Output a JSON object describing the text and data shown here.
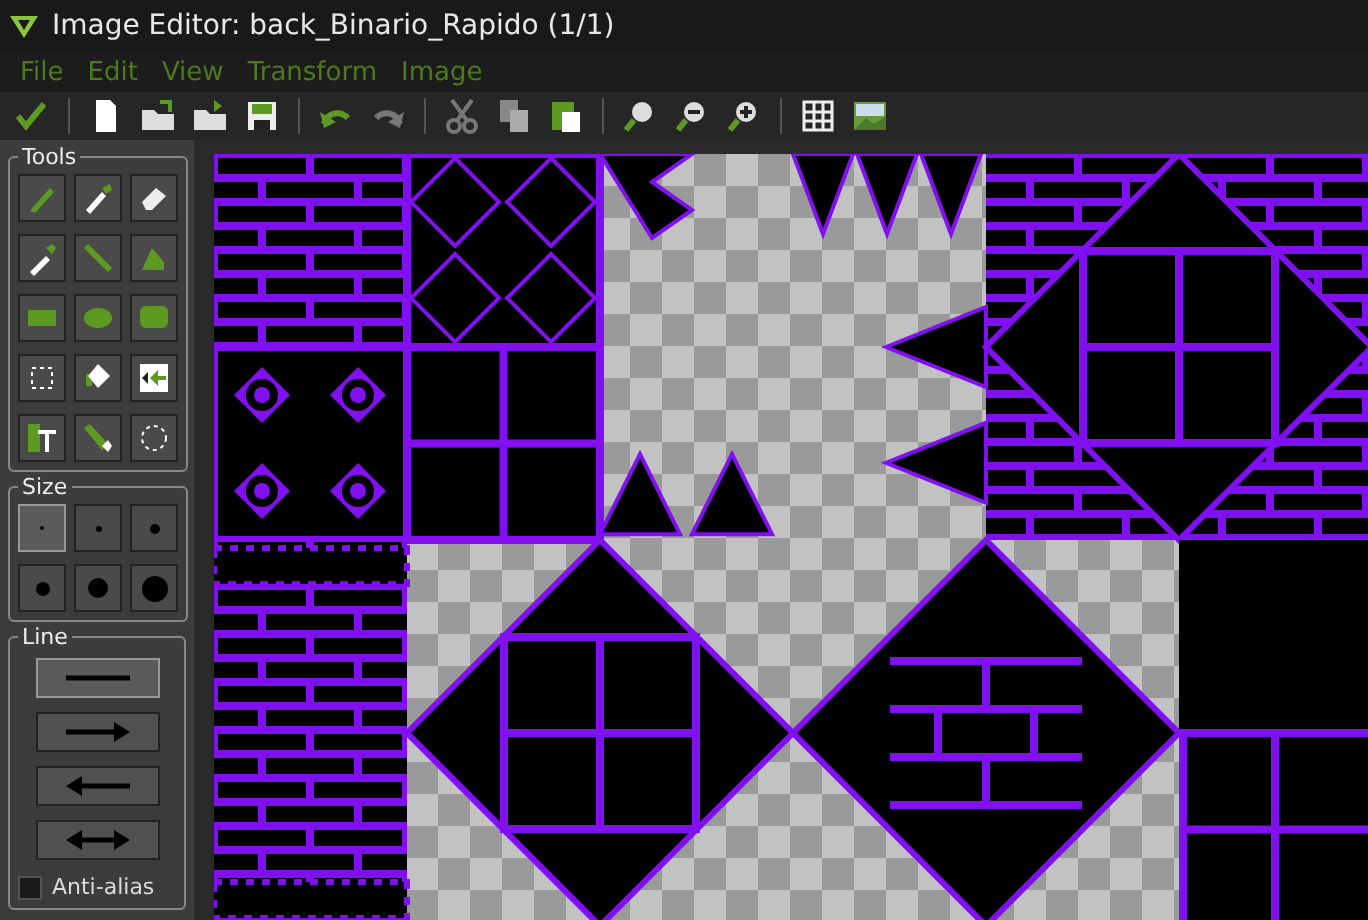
{
  "window": {
    "title": "Image Editor: back_Binario_Rapido (1/1)"
  },
  "menu": [
    "File",
    "Edit",
    "View",
    "Transform",
    "Image"
  ],
  "panels": {
    "tools": {
      "title": "Tools"
    },
    "size": {
      "title": "Size",
      "buttons": [
        {
          "selected": true
        },
        {
          "selected": false
        },
        {
          "selected": false
        },
        {
          "selected": false
        },
        {
          "selected": false
        },
        {
          "selected": false
        }
      ]
    },
    "line": {
      "title": "Line",
      "buttons": [
        {
          "selected": true
        },
        {
          "selected": false
        },
        {
          "selected": false
        },
        {
          "selected": false
        }
      ],
      "anti_alias": {
        "label": "Anti-alias",
        "checked": false
      }
    }
  }
}
